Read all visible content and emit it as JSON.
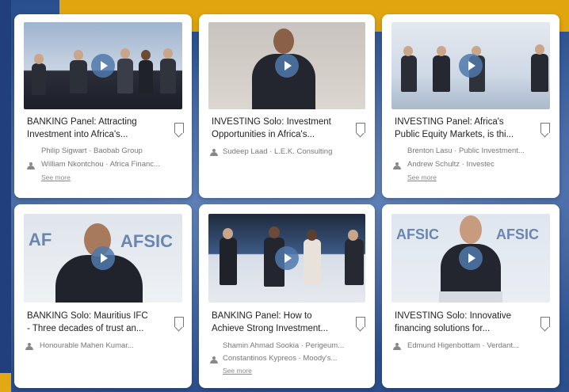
{
  "colors": {
    "banner": "#e1a50f",
    "background": "#2a4f8f",
    "card": "#ffffff",
    "accent_play": "#5078aa"
  },
  "cards": [
    {
      "title": "BANKING Panel: Attracting\nInvestment into Africa's...",
      "speakers": [
        "Philip Sigwart · Baobab Group",
        "William Nkontchou · Africa Financ..."
      ],
      "see_more": "See more"
    },
    {
      "title": "INVESTING Solo: Investment\nOpportunities in Africa's...",
      "speakers": [
        "Sudeep Laad · L.E.K. Consulting"
      ],
      "see_more": ""
    },
    {
      "title": "INVESTING Panel: Africa's\nPublic Equity Markets, is thi...",
      "speakers": [
        "Brenton Lasu · Public Investment...",
        "Andrew Schultz · Investec"
      ],
      "see_more": "See more"
    },
    {
      "title": "BANKING Solo: Mauritius IFC\n- Three decades of trust an...",
      "speakers": [
        "Honourable Mahen Kumar..."
      ],
      "see_more": "",
      "thumb_text": [
        "AF",
        "AFSIC"
      ]
    },
    {
      "title": "BANKING Panel: How to\nAchieve Strong Investment...",
      "speakers": [
        "Shamin Ahmad Sookia · Perigeum...",
        "Constantinos Kypreos · Moody's..."
      ],
      "see_more": "See more"
    },
    {
      "title": "INVESTING Solo: Innovative\nfinancing solutions for...",
      "speakers": [
        "Edmund Higenbottam · Verdant..."
      ],
      "see_more": "",
      "thumb_text": [
        "AFSIC",
        "AFSIC"
      ]
    }
  ],
  "icons": {
    "play": "play-icon",
    "bookmark": "bookmark-icon",
    "speakers": "people-icon"
  }
}
